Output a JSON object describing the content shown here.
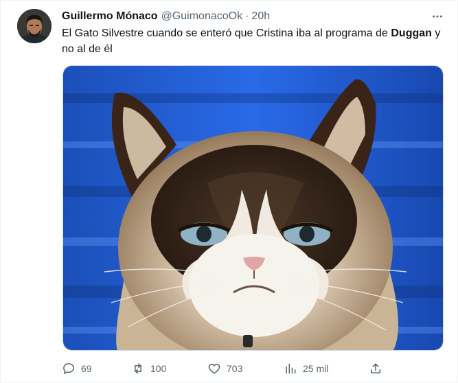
{
  "tweet": {
    "author": {
      "name": "Guillermo Mónaco",
      "handle": "@GuimonacoOk",
      "separator": "·",
      "time": "20h"
    },
    "text_part1": "El Gato Silvestre cuando se enteró que Cristina iba al programa de ",
    "text_bold": "Duggan",
    "text_part2": " y no al de él",
    "more_icon": "more-horizontal-icon",
    "actions": {
      "replies": "69",
      "retweets": "100",
      "likes": "703",
      "views": "25 mil"
    }
  },
  "colors": {
    "text_primary": "#0f1419",
    "text_secondary": "#536471",
    "media_background_blue": "#1f5fd6"
  }
}
